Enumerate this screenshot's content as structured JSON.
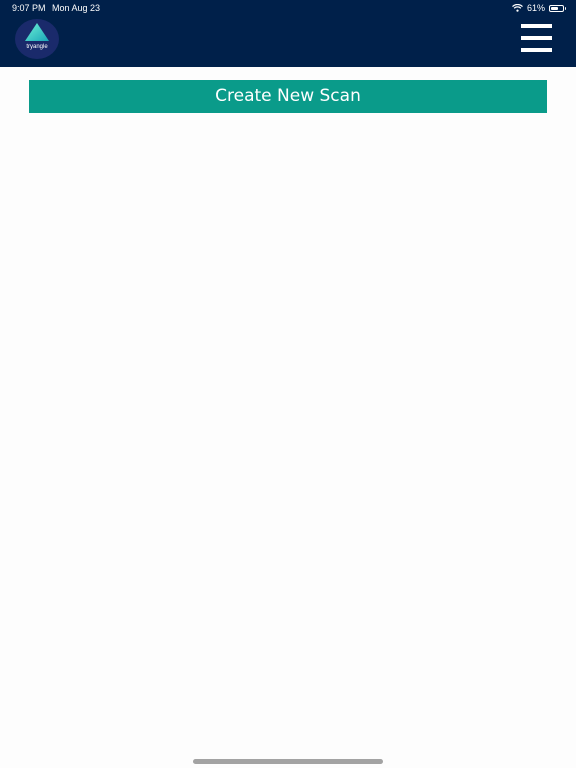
{
  "status_bar": {
    "time": "9:07 PM",
    "date": "Mon Aug 23",
    "battery_percent_label": "61%",
    "battery_level": 0.61,
    "wifi_icon": "wifi-icon",
    "battery_icon": "battery-icon"
  },
  "header": {
    "logo_text": "tryangle",
    "menu_icon": "hamburger-menu-icon",
    "background_color": "#00204a"
  },
  "main": {
    "create_button_label": "Create New Scan",
    "create_button_color": "#0a9b8a"
  }
}
